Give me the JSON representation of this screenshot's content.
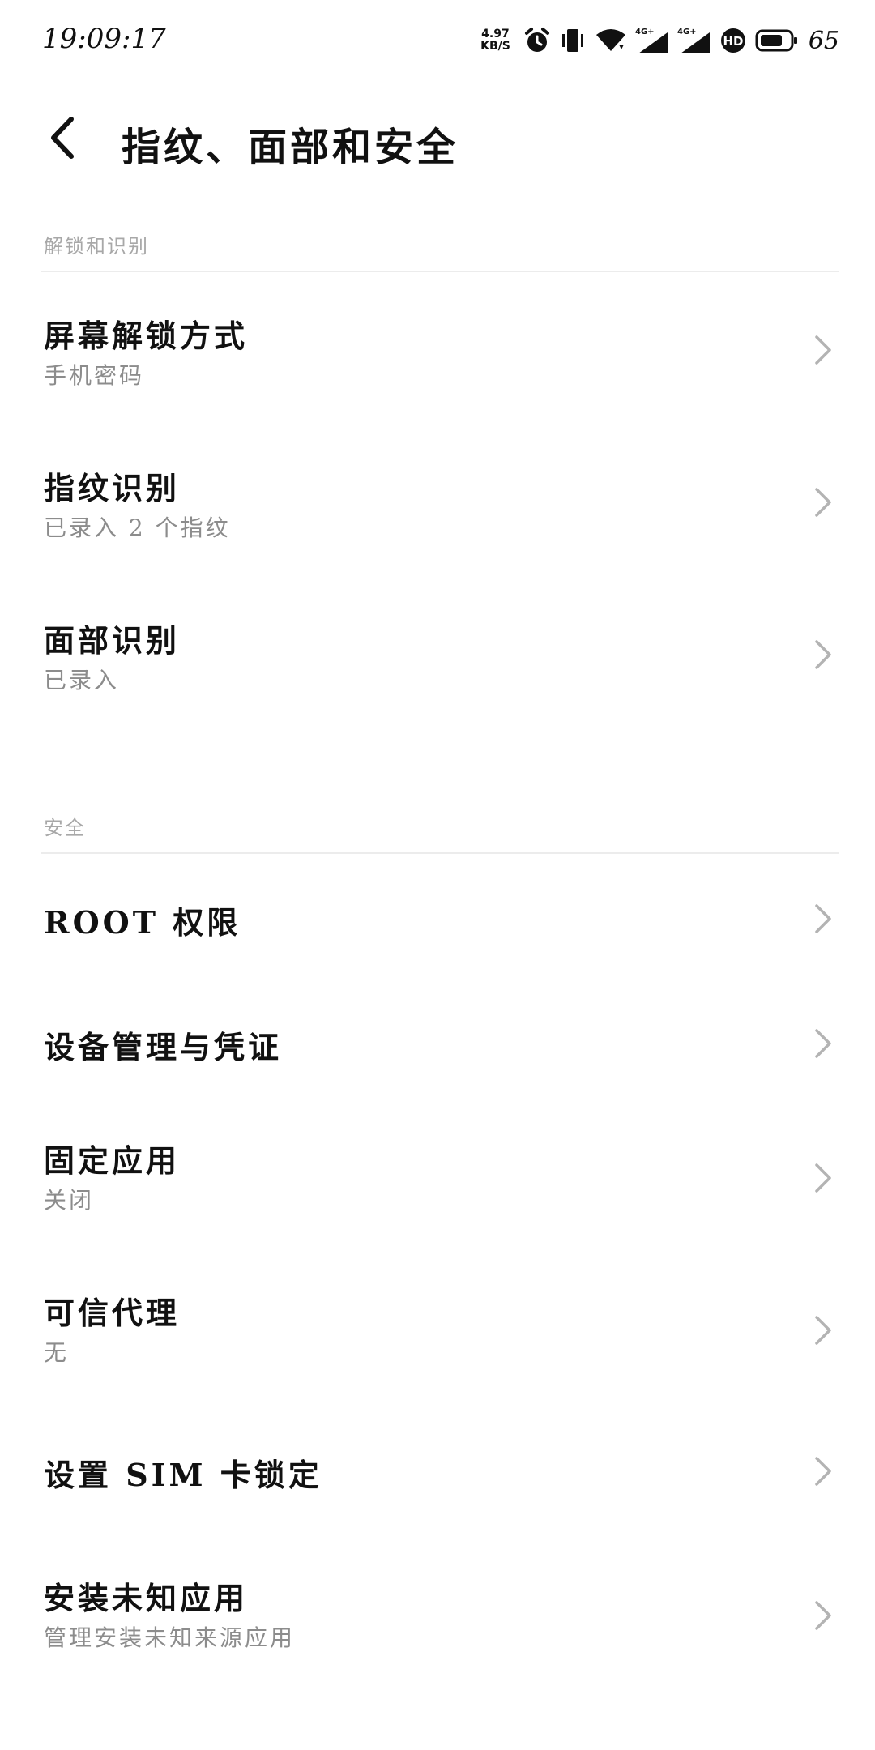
{
  "status_bar": {
    "time": "19:09:17",
    "net_speed_value": "4.97",
    "net_speed_unit": "KB/S",
    "network_1": "4G+",
    "network_2": "4G+",
    "hd_badge": "HD",
    "battery_percent": "65",
    "icons": [
      "alarm-icon",
      "vibrate-icon",
      "wifi-icon",
      "signal-icon",
      "signal-icon",
      "hd-icon",
      "battery-icon"
    ]
  },
  "header": {
    "back_icon": "back-arrow-icon",
    "title": "指纹、面部和安全"
  },
  "sections": [
    {
      "header": "解锁和识别",
      "items": [
        {
          "title": "屏幕解锁方式",
          "subtitle": "手机密码"
        },
        {
          "title": "指纹识别",
          "subtitle": "已录入 2 个指纹"
        },
        {
          "title": "面部识别",
          "subtitle": "已录入"
        }
      ]
    },
    {
      "header": "安全",
      "items": [
        {
          "title": "ROOT 权限",
          "subtitle": ""
        },
        {
          "title": "设备管理与凭证",
          "subtitle": ""
        },
        {
          "title": "固定应用",
          "subtitle": "关闭"
        },
        {
          "title": "可信代理",
          "subtitle": "无"
        },
        {
          "title": "设置 SIM 卡锁定",
          "subtitle": ""
        },
        {
          "title": "安装未知应用",
          "subtitle": "管理安装未知来源应用"
        }
      ]
    }
  ],
  "colors": {
    "background": "#ffffff",
    "title_text": "#111111",
    "subtitle_text": "#8c8c8c",
    "section_header_text": "#a8a8a8",
    "divider": "#ececec",
    "chevron": "#b3b3b3"
  }
}
